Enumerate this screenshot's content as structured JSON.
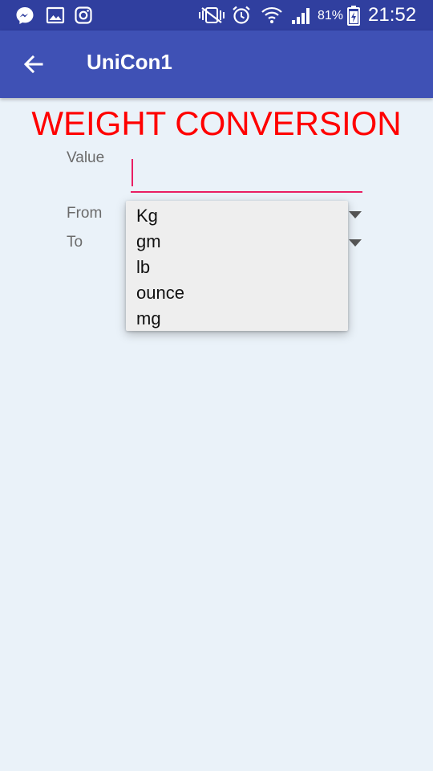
{
  "status_bar": {
    "battery": "81%",
    "time": "21:52",
    "notification_icons": [
      "messenger-icon",
      "gallery-icon",
      "instagram-icon"
    ],
    "system_icons": [
      "vibrate-icon",
      "alarm-icon",
      "wifi-icon",
      "signal-icon",
      "battery-charging-icon"
    ]
  },
  "app_bar": {
    "title": "UniCon1",
    "back_icon": "arrow-back-icon"
  },
  "heading": "WEIGHT CONVERSION",
  "form": {
    "value_label": "Value",
    "value_input": "",
    "from_label": "From",
    "to_label": "To"
  },
  "dropdown": {
    "options": [
      "Kg",
      "gm",
      "lb",
      "ounce",
      "mg"
    ]
  },
  "colors": {
    "status_bar": "#303F9F",
    "app_bar": "#3F51B5",
    "heading": "#FF0000",
    "accent": "#E91E63",
    "background": "#EAF2F9"
  }
}
